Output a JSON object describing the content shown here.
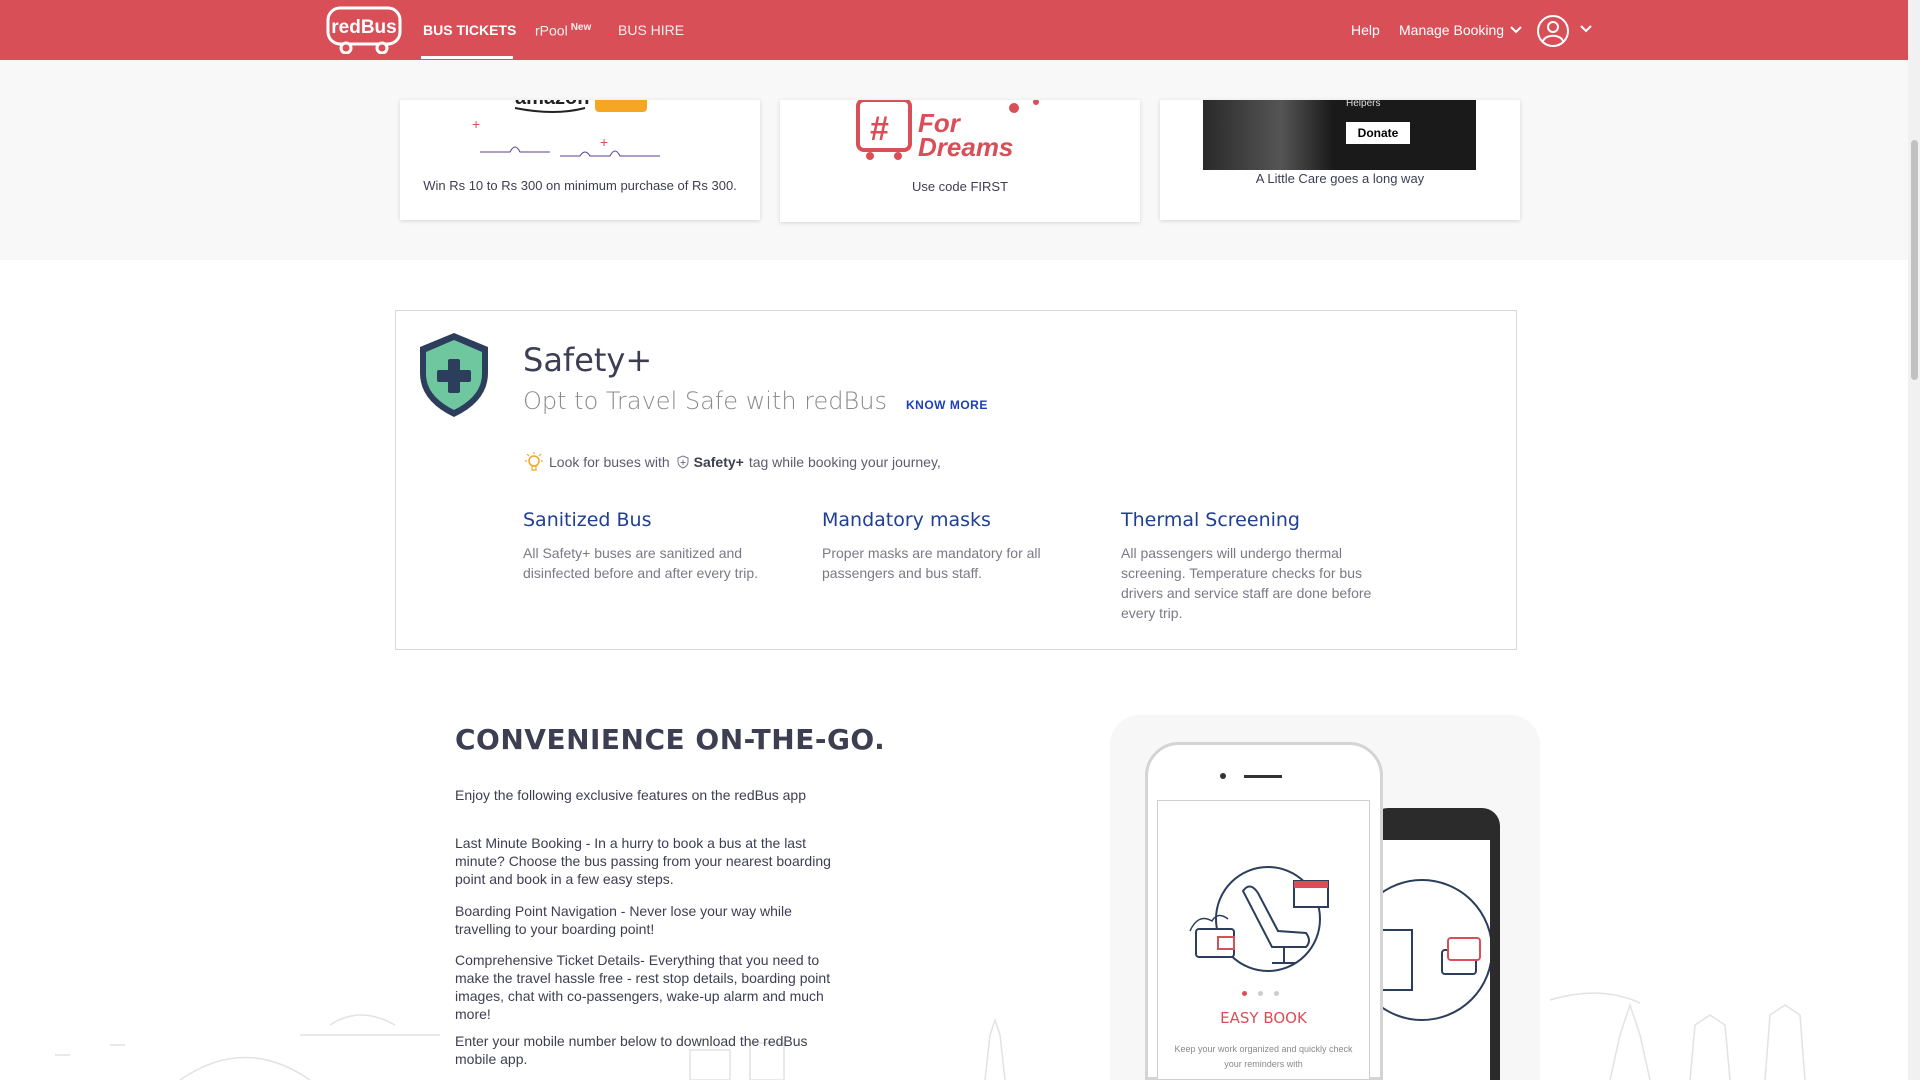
{
  "header": {
    "logo_text": "redBus",
    "nav": {
      "bus_tickets": "BUS TICKETS",
      "rpool": "rPool",
      "rpool_badge": "New",
      "bus_hire": "BUS HIRE"
    },
    "help": "Help",
    "manage_booking": "Manage Booking"
  },
  "offers": [
    {
      "caption": "Win Rs 10 to Rs 300 on minimum purchase of Rs 300.",
      "brand": "amazon pay"
    },
    {
      "caption": "Use code FIRST",
      "banner_text_1": "For",
      "banner_text_2": "Dreams"
    },
    {
      "caption": "A Little Care goes a long way",
      "small_text": "Helpers",
      "button": "Donate"
    }
  ],
  "safety": {
    "title": "Safety+",
    "subtitle": "Opt to Travel Safe with redBus",
    "know_more": "KNOW MORE",
    "tip_prefix": "Look for buses with",
    "tip_tag": "Safety+",
    "tip_suffix": "tag while booking your journey,",
    "features": [
      {
        "title": "Sanitized Bus",
        "desc": "All Safety+ buses are sanitized and disinfected before and after every trip."
      },
      {
        "title": "Mandatory masks",
        "desc": "Proper masks are mandatory for all passengers and bus staff."
      },
      {
        "title": "Thermal Screening",
        "desc": "All passengers will undergo thermal screening. Temperature checks for bus drivers and service staff are done before every trip."
      }
    ]
  },
  "convenience": {
    "title": "CONVENIENCE ON-THE-GO.",
    "paragraphs": [
      "Enjoy the following exclusive features on the redBus app",
      "Last Minute Booking - In a hurry to book a bus at the last minute? Choose the bus passing from your nearest boarding point and book in a few easy steps.",
      "Boarding Point Navigation - Never lose your way while travelling to your boarding point!",
      "Comprehensive Ticket Details- Everything that you need to make the travel hassle free - rest stop details, boarding point images, chat with co-passengers, wake-up alarm and much more!",
      "Enter your mobile number below to download the redBus mobile app."
    ],
    "phone": {
      "heading": "EASY BOOK",
      "desc": "Keep your work organized and quickly check your reminders with"
    }
  },
  "colors": {
    "brand_red": "#d84f57",
    "link_blue": "#1d3fbb",
    "feature_blue": "#1f3f93",
    "shield_green": "#6fc7a0",
    "shield_navy": "#2c3e5c"
  }
}
